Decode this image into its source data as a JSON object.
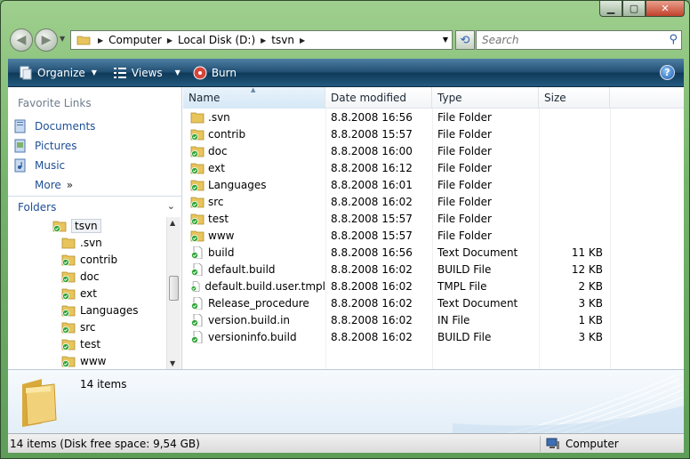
{
  "address": {
    "crumbs": [
      "Computer",
      "Local Disk (D:)",
      "tsvn"
    ]
  },
  "search": {
    "placeholder": "Search"
  },
  "toolbar": {
    "organize": "Organize",
    "views": "Views",
    "burn": "Burn",
    "help": "?"
  },
  "nav": {
    "favorites_title": "Favorite Links",
    "favorites": [
      {
        "label": "Documents",
        "icon": "documents-icon"
      },
      {
        "label": "Pictures",
        "icon": "pictures-icon"
      },
      {
        "label": "Music",
        "icon": "music-icon"
      }
    ],
    "more": "More",
    "more_glyph": "»",
    "folders_title": "Folders",
    "tree_root": "tsvn",
    "tree_children": [
      ".svn",
      "contrib",
      "doc",
      "ext",
      "Languages",
      "src",
      "test",
      "www"
    ]
  },
  "columns": {
    "name": "Name",
    "date": "Date modified",
    "type": "Type",
    "size": "Size"
  },
  "files": [
    {
      "name": ".svn",
      "date": "8.8.2008 16:56",
      "type": "File Folder",
      "size": "",
      "kind": "plain-folder"
    },
    {
      "name": "contrib",
      "date": "8.8.2008 15:57",
      "type": "File Folder",
      "size": "",
      "kind": "svn-folder"
    },
    {
      "name": "doc",
      "date": "8.8.2008 16:00",
      "type": "File Folder",
      "size": "",
      "kind": "svn-folder"
    },
    {
      "name": "ext",
      "date": "8.8.2008 16:12",
      "type": "File Folder",
      "size": "",
      "kind": "svn-folder"
    },
    {
      "name": "Languages",
      "date": "8.8.2008 16:01",
      "type": "File Folder",
      "size": "",
      "kind": "svn-folder"
    },
    {
      "name": "src",
      "date": "8.8.2008 16:02",
      "type": "File Folder",
      "size": "",
      "kind": "svn-folder"
    },
    {
      "name": "test",
      "date": "8.8.2008 15:57",
      "type": "File Folder",
      "size": "",
      "kind": "svn-folder"
    },
    {
      "name": "www",
      "date": "8.8.2008 15:57",
      "type": "File Folder",
      "size": "",
      "kind": "svn-folder"
    },
    {
      "name": "build",
      "date": "8.8.2008 16:56",
      "type": "Text Document",
      "size": "11 KB",
      "kind": "svn-file"
    },
    {
      "name": "default.build",
      "date": "8.8.2008 16:02",
      "type": "BUILD File",
      "size": "12 KB",
      "kind": "svn-file"
    },
    {
      "name": "default.build.user.tmpl",
      "date": "8.8.2008 16:02",
      "type": "TMPL File",
      "size": "2 KB",
      "kind": "svn-file"
    },
    {
      "name": "Release_procedure",
      "date": "8.8.2008 16:02",
      "type": "Text Document",
      "size": "3 KB",
      "kind": "svn-file"
    },
    {
      "name": "version.build.in",
      "date": "8.8.2008 16:02",
      "type": "IN File",
      "size": "1 KB",
      "kind": "svn-file"
    },
    {
      "name": "versioninfo.build",
      "date": "8.8.2008 16:02",
      "type": "BUILD File",
      "size": "3 KB",
      "kind": "svn-file"
    }
  ],
  "details": {
    "count": "14 items"
  },
  "status": {
    "left": "14 items (Disk free space: 9,54 GB)",
    "right": "Computer"
  },
  "colors": {
    "accent_link": "#1e4e96",
    "toolbar_dark": "#0f3958",
    "svn_ok_green": "#2fa536",
    "folder_yellow": "#e8c45c"
  }
}
